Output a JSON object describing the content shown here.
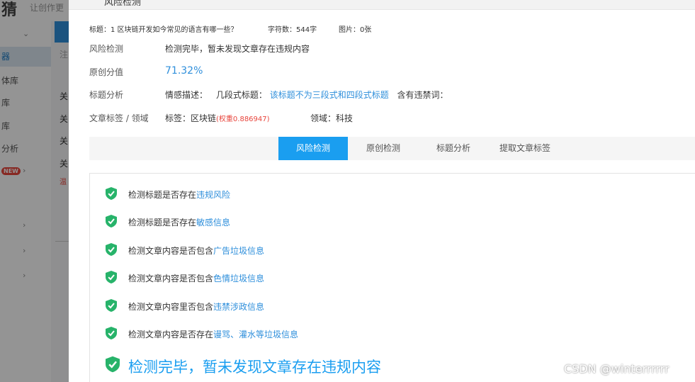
{
  "background": {
    "brand": "猜",
    "subtitle": "让创作更",
    "sidebar": [
      {
        "label": "",
        "chevron": "⌄"
      },
      {
        "label": "器",
        "active": true
      },
      {
        "label": "体库"
      },
      {
        "label": "库"
      },
      {
        "label": "库"
      },
      {
        "label": "分析"
      },
      {
        "label": "",
        "badge": "NEW",
        "chevron": "›"
      },
      {
        "label": "",
        "chevron": "›"
      },
      {
        "label": "",
        "chevron": "›"
      },
      {
        "label": "",
        "chevron": "›"
      }
    ],
    "main_texts": [
      "注",
      "关",
      "关",
      "关",
      "关",
      "温"
    ]
  },
  "modal": {
    "title": "风险检测",
    "info": {
      "title_text": "标题：1 区块链开发如今常见的语言有哪一些？",
      "char_count": "字符数：544字",
      "image_count": "图片：0张"
    },
    "rows": {
      "risk_label": "风险检测",
      "risk_value": "检测完毕，暂未发现文章存在违规内容",
      "original_label": "原创分值",
      "original_value": "71.32%",
      "title_label": "标题分析",
      "emotion": "情感描述：",
      "structure_prefix": "几段式标题：",
      "structure_value": "该标题不为三段式和四段式标题",
      "banned": "含有违禁词：",
      "tags_label": "文章标签 / 领域",
      "tag_prefix": "标签：区块链",
      "tag_weight": "(权重0.886947)",
      "domain": "领域：科技"
    },
    "tabs": [
      {
        "label": "风险检测",
        "active": true
      },
      {
        "label": "原创检测"
      },
      {
        "label": "标题分析"
      },
      {
        "label": "提取文章标签"
      }
    ],
    "checks": [
      {
        "prefix": "检测标题是否存在",
        "link": "违规风险"
      },
      {
        "prefix": "检测标题是否存在",
        "link": "敏感信息"
      },
      {
        "prefix": "检测文章内容是否包含",
        "link": "广告垃圾信息"
      },
      {
        "prefix": "检测文章内容是否包含",
        "link": "色情垃圾信息"
      },
      {
        "prefix": "检测文章内容里否包含",
        "link": "违禁涉政信息"
      },
      {
        "prefix": "检测文章内容是否存在",
        "link": "谩骂、灌水等垃圾信息"
      }
    ],
    "final": "检测完毕，暂未发现文章存在违规内容"
  },
  "watermark": "CSDN @winterrrrrr",
  "colors": {
    "accent": "#1a9ef0",
    "link": "#2f8fdb",
    "check_green": "#27b36a",
    "weight_red": "#e8453c"
  }
}
